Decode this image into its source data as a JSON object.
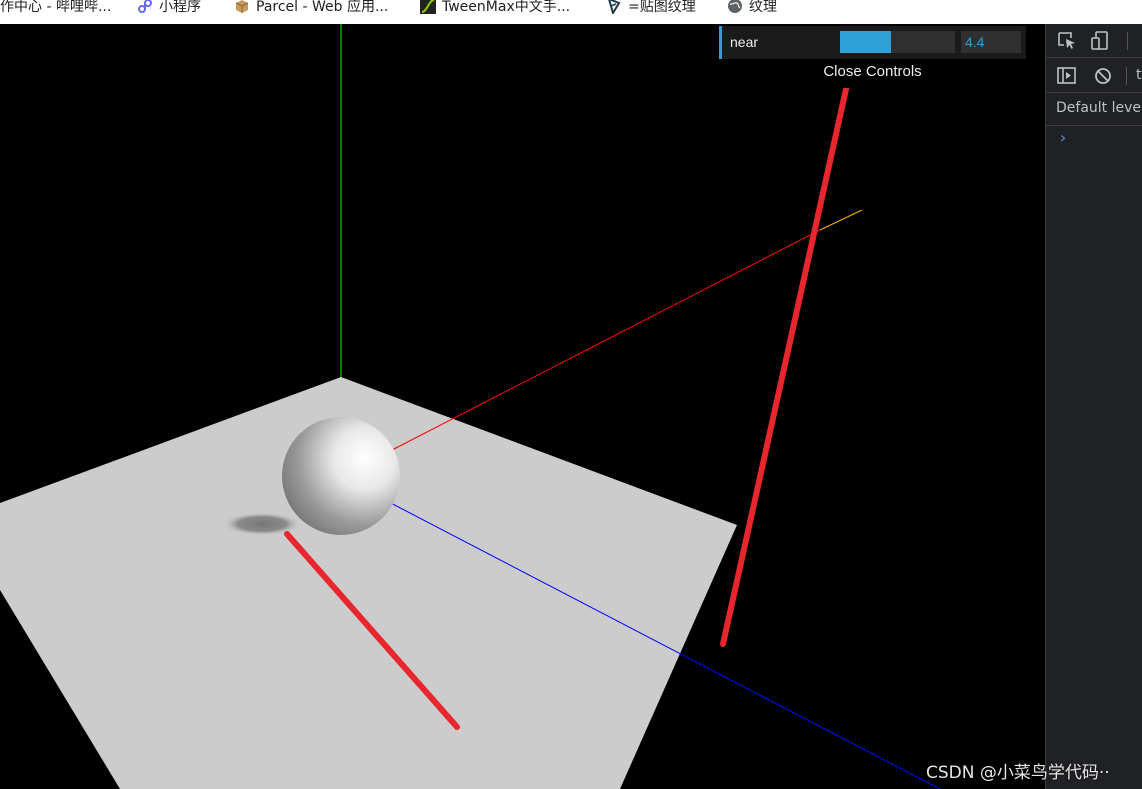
{
  "bookmarks": [
    {
      "label": "作中心 - 哔哩哔...",
      "icon": "bilibili-icon"
    },
    {
      "label": "小程序",
      "icon": "miniprogram-icon"
    },
    {
      "label": "Parcel - Web 应用...",
      "icon": "parcel-box-icon"
    },
    {
      "label": "TweenMax中文手...",
      "icon": "tweenmax-icon"
    },
    {
      "label": "=贴图纹理",
      "icon": "threejs-icon"
    },
    {
      "label": "纹理",
      "icon": "globe-icon"
    }
  ],
  "gui": {
    "controls": [
      {
        "label": "near",
        "value": "4.4",
        "slider_fraction": 0.44
      }
    ],
    "close_label": "Close Controls",
    "accent_color": "#2fa1d6"
  },
  "devtools": {
    "filter_text": "t",
    "levels_label": "Default levels",
    "prompt_symbol": "›"
  },
  "watermark": "CSDN @小菜鸟学代码··",
  "scene": {
    "background": "#000000",
    "plane_color": "#cccccc",
    "axes_colors": {
      "x": "#ff0000",
      "y": "#00ff00",
      "z": "#0000ff"
    },
    "camera_helper_color": "#ffaa00",
    "annotation_color": "#e8262e"
  }
}
